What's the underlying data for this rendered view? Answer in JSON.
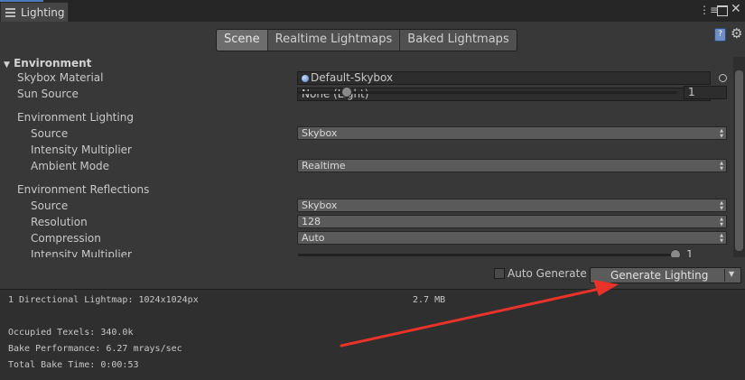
{
  "window": {
    "tab_title": "Lighting",
    "menu_icon": "menu-dots-icon",
    "maximize_icon": "maximize-icon",
    "close_icon": "close-icon"
  },
  "tabs": [
    "Scene",
    "Realtime Lightmaps",
    "Baked Lightmaps"
  ],
  "active_tab": "Scene",
  "environment": {
    "header": "Environment",
    "skybox_material_label": "Skybox Material",
    "skybox_material_value": "Default-Skybox",
    "sun_source_label": "Sun Source",
    "sun_source_value": "None (Light)",
    "env_lighting_header": "Environment Lighting",
    "lighting_source_label": "Source",
    "lighting_source_value": "Skybox",
    "intensity_label": "Intensity Multiplier",
    "intensity_value": "1",
    "intensity_fraction": 0.125,
    "ambient_mode_label": "Ambient Mode",
    "ambient_mode_value": "Realtime",
    "env_reflections_header": "Environment Reflections",
    "reflections_source_label": "Source",
    "reflections_source_value": "Skybox",
    "resolution_label": "Resolution",
    "resolution_value": "128",
    "compression_label": "Compression",
    "compression_value": "Auto",
    "reflection_intensity_label_partial": "Intensity Multiplier",
    "reflection_intensity_value_partial": "1"
  },
  "toolbar": {
    "auto_generate_label": "Auto Generate",
    "auto_generate_checked": false,
    "generate_label": "Generate Lighting"
  },
  "stats": {
    "lightmaps": "1 Directional Lightmap: 1024x1024px",
    "size": "2.7 MB",
    "texels": "Occupied Texels: 340.0k",
    "bake_perf": "Bake Performance: 6.27 mrays/sec",
    "bake_time": "Total Bake Time: 0:00:53"
  },
  "colors": {
    "background": "#383838",
    "annotation_arrow": "#e8322a",
    "active_tab": "#6d6d6d"
  }
}
